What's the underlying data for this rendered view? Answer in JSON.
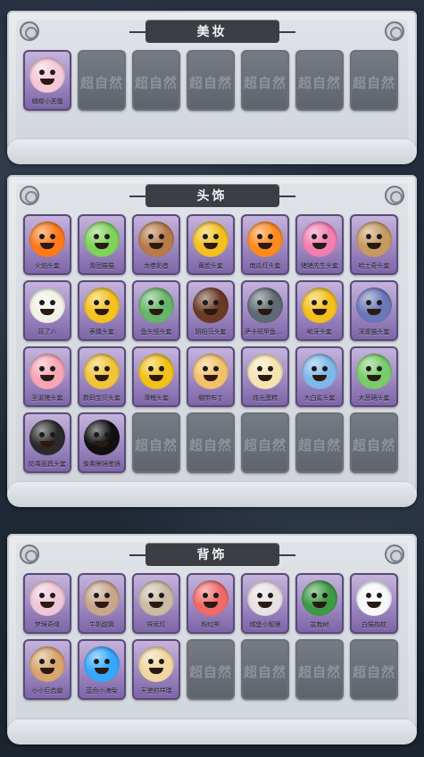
{
  "colors": {
    "background": "#1f2733",
    "panel": "#e2e6eb",
    "tile_filled": "#8f76b8",
    "tile_empty": "#6b7078",
    "title_bar": "#3b3f45"
  },
  "sections": [
    {
      "id": "makeup",
      "title": "美妆",
      "watermark": "超自然",
      "items": [
        {
          "label": "蝴蝶小恶魔",
          "icon": "demon-makeup-icon",
          "color": "#f5c8d7"
        }
      ],
      "empty_slots": 6
    },
    {
      "id": "headwear",
      "title": "头饰",
      "watermark": "超自然",
      "items": [
        {
          "label": "火焰头套",
          "icon": "flame-head-icon",
          "color": "#ff7a1a"
        },
        {
          "label": "青团猫猫",
          "icon": "green-bun-icon",
          "color": "#7fd25a"
        },
        {
          "label": "龙卷奶昔",
          "icon": "chest-head-icon",
          "color": "#b77a4a"
        },
        {
          "label": "黄脸头套",
          "icon": "yellow-face-icon",
          "color": "#f2c120"
        },
        {
          "label": "南瓜灯头套",
          "icon": "pumpkin-head-icon",
          "color": "#ff8a1d"
        },
        {
          "label": "猪猪先生头套",
          "icon": "pig-head-icon",
          "color": "#f27fb2"
        },
        {
          "label": "哈士奇头套",
          "icon": "dog-head-icon",
          "color": "#c79a62"
        },
        {
          "label": "蒜了八",
          "icon": "garlic-head-icon",
          "color": "#f1f1e8"
        },
        {
          "label": "表情头套",
          "icon": "emoji-dizzy-icon",
          "color": "#f5c21f"
        },
        {
          "label": "鱼头怪头套",
          "icon": "fish-head-icon",
          "color": "#67b56a"
        },
        {
          "label": "阴阳马头套",
          "icon": "horse-head-icon",
          "color": "#6a3b24"
        },
        {
          "label": "萨卡班甲鱼头套",
          "icon": "fish-creature-icon",
          "color": "#5f6a74"
        },
        {
          "label": "呲牙头套",
          "icon": "grin-face-icon",
          "color": "#f3c01c"
        },
        {
          "label": "深邃猫头套",
          "icon": "blue-cat-icon",
          "color": "#6c77b9"
        },
        {
          "label": "圣诞猪头套",
          "icon": "santa-pig-icon",
          "color": "#f7a6b6"
        },
        {
          "label": "数码宝贝头套",
          "icon": "pika-head-icon",
          "color": "#f1c53a"
        },
        {
          "label": "滑稽头套",
          "icon": "smile-face-icon",
          "color": "#f2c219"
        },
        {
          "label": "绷带布丁",
          "icon": "pudding-head-icon",
          "color": "#f2c26b"
        },
        {
          "label": "烛光蛋糕",
          "icon": "candle-head-icon",
          "color": "#f6e3b2"
        },
        {
          "label": "大白鲨头套",
          "icon": "shark-head-icon",
          "color": "#7fb8e8"
        },
        {
          "label": "大葱萌头套",
          "icon": "leek-head-icon",
          "color": "#7acb6b"
        },
        {
          "label": "防毒面具头套",
          "icon": "gas-mask-icon",
          "color": "#2b2b2b"
        },
        {
          "label": "像素眼镜墨镜",
          "icon": "pixel-glasses-icon",
          "color": "#111111"
        }
      ],
      "empty_slots": 5
    },
    {
      "id": "back_accessory",
      "title": "背饰",
      "watermark": "超自然",
      "items": [
        {
          "label": "梦境奇缘",
          "icon": "plush-backpack-icon",
          "color": "#f0c7d7"
        },
        {
          "label": "牛奶甜筒",
          "icon": "milk-bucket-icon",
          "color": "#c8a68a"
        },
        {
          "label": "探索灯",
          "icon": "lantern-icon",
          "color": "#cbbba4"
        },
        {
          "label": "粉红熊",
          "icon": "pink-bear-icon",
          "color": "#f06a6a"
        },
        {
          "label": "城堡小狐狸",
          "icon": "fox-plush-icon",
          "color": "#e7e1e3"
        },
        {
          "label": "盆栽树",
          "icon": "bonsai-icon",
          "color": "#3e9a45"
        },
        {
          "label": "白猫抱枕",
          "icon": "white-cat-pillow-icon",
          "color": "#f6f7f8"
        },
        {
          "label": "小小巨齿兽",
          "icon": "lion-plush-icon",
          "color": "#d8a46f"
        },
        {
          "label": "蓝色小海兔",
          "icon": "blue-dog-icon",
          "color": "#35a9ff"
        },
        {
          "label": "天使的祥瑞",
          "icon": "angel-doll-icon",
          "color": "#f2d6a1"
        }
      ],
      "empty_slots": 4
    }
  ]
}
